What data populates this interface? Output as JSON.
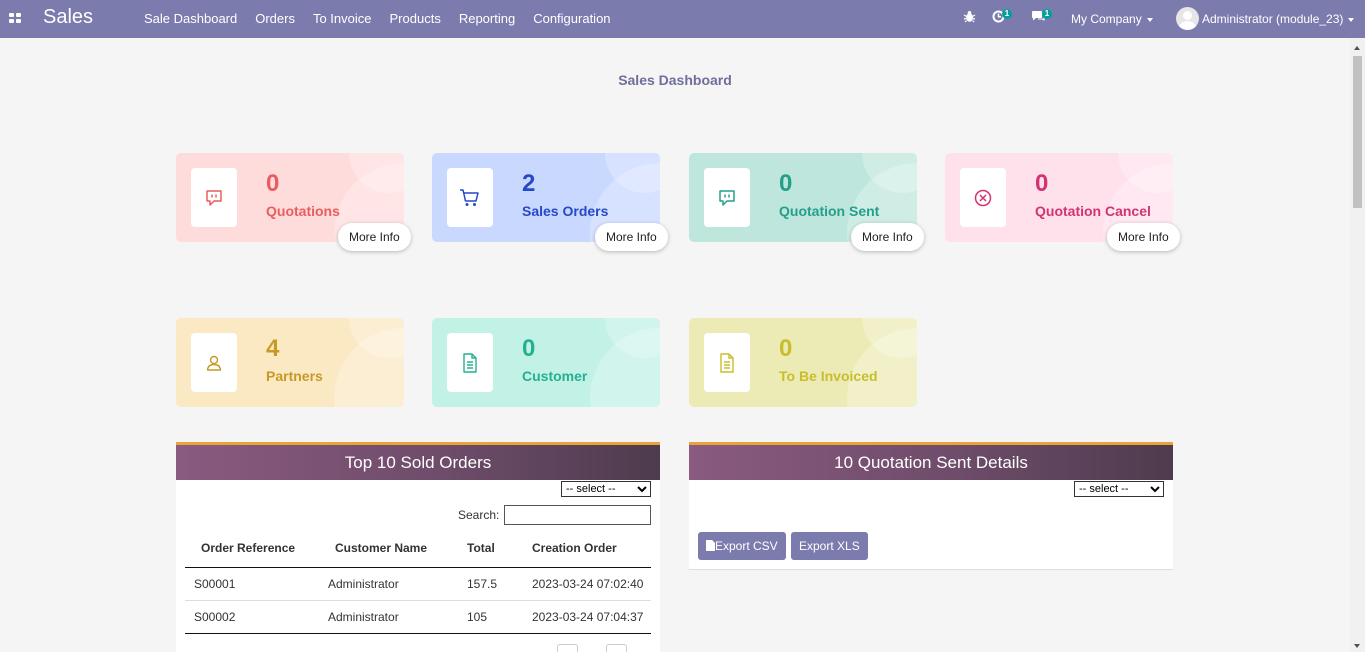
{
  "nav": {
    "brand": "Sales",
    "menu": [
      "Sale Dashboard",
      "Orders",
      "To Invoice",
      "Products",
      "Reporting",
      "Configuration"
    ],
    "activity_count": "1",
    "message_count": "1",
    "company": "My Company",
    "user": "Administrator (module_23)"
  },
  "page_title": "Sales Dashboard",
  "cards": [
    {
      "count": "0",
      "label": "Quotations",
      "more": "More Info",
      "icon": "chat-bubble-icon",
      "color": "#e85d5d"
    },
    {
      "count": "2",
      "label": "Sales Orders",
      "more": "More Info",
      "icon": "cart-icon",
      "color": "#2549c9"
    },
    {
      "count": "0",
      "label": "Quotation Sent",
      "more": "More Info",
      "icon": "chat-bubble-icon",
      "color": "#23a08a"
    },
    {
      "count": "0",
      "label": "Quotation Cancel",
      "more": "More Info",
      "icon": "cancel-circle-icon",
      "color": "#d23471"
    },
    {
      "count": "4",
      "label": "Partners",
      "icon": "user-icon",
      "color": "#c79a28"
    },
    {
      "count": "0",
      "label": "Customer",
      "icon": "document-icon",
      "color": "#25b092"
    },
    {
      "count": "0",
      "label": "To Be Invoiced",
      "icon": "document-icon",
      "color": "#c8be2c"
    }
  ],
  "sold_orders": {
    "title": "Top 10 Sold Orders",
    "select_placeholder": "-- select --",
    "search_label": "Search:",
    "columns": [
      "Order Reference",
      "Customer Name",
      "Total",
      "Creation Order"
    ],
    "rows": [
      [
        "S00001",
        "Administrator",
        "157.5",
        "2023-03-24 07:02:40"
      ],
      [
        "S00002",
        "Administrator",
        "105",
        "2023-03-24 07:04:37"
      ]
    ]
  },
  "quotation_sent": {
    "title": "10 Quotation Sent Details",
    "select_placeholder": "-- select --",
    "export_csv": "Export CSV",
    "export_xls": "Export XLS"
  }
}
